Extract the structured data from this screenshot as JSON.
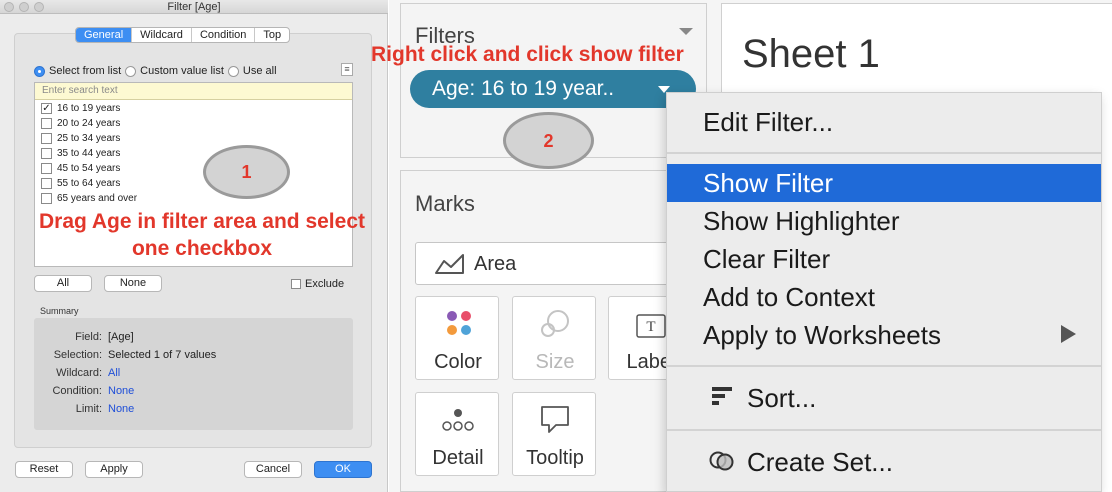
{
  "dialog": {
    "title": "Filter [Age]",
    "tabs": [
      "General",
      "Wildcard",
      "Condition",
      "Top"
    ],
    "radios": [
      "Select from list",
      "Custom value list",
      "Use all"
    ],
    "search_placeholder": "Enter search text",
    "items": [
      {
        "label": "16 to 19 years",
        "checked": true
      },
      {
        "label": "20 to 24 years",
        "checked": false
      },
      {
        "label": "25 to 34 years",
        "checked": false
      },
      {
        "label": "35 to 44 years",
        "checked": false
      },
      {
        "label": "45 to 54 years",
        "checked": false
      },
      {
        "label": "55 to 64 years",
        "checked": false
      },
      {
        "label": "65 years and over",
        "checked": false
      }
    ],
    "all_label": "All",
    "none_label": "None",
    "exclude_label": "Exclude",
    "summary_label": "Summary",
    "summary": [
      {
        "key": "Field:",
        "value": "[Age]"
      },
      {
        "key": "Selection:",
        "value": "Selected 1 of 7 values"
      },
      {
        "key": "Wildcard:",
        "value": "All"
      },
      {
        "key": "Condition:",
        "value": "None"
      },
      {
        "key": "Limit:",
        "value": "None"
      }
    ],
    "reset_label": "Reset",
    "apply_label": "Apply",
    "cancel_label": "Cancel",
    "ok_label": "OK"
  },
  "annotations": {
    "step1_number": "1",
    "step1_text": "Drag Age in filter area and select one checkbox",
    "step2_number": "2",
    "step2_text": "Right click and click show filter",
    "color": "#e2372b"
  },
  "filters_pane": {
    "title": "Filters",
    "pill_text": "Age: 16 to 19 year..",
    "pill_color": "#2f7fa0"
  },
  "marks_pane": {
    "title": "Marks",
    "mark_type": "Area",
    "cards": [
      "Color",
      "Size",
      "Label",
      "Detail",
      "Tooltip"
    ]
  },
  "sheet": {
    "title": "Sheet 1"
  },
  "context_menu": {
    "items": [
      "Edit Filter...",
      "Show Filter",
      "Show Highlighter",
      "Clear Filter",
      "Add to Context",
      "Apply to Worksheets",
      "Sort...",
      "Create Set..."
    ],
    "highlight_color": "#1f6ad8"
  }
}
